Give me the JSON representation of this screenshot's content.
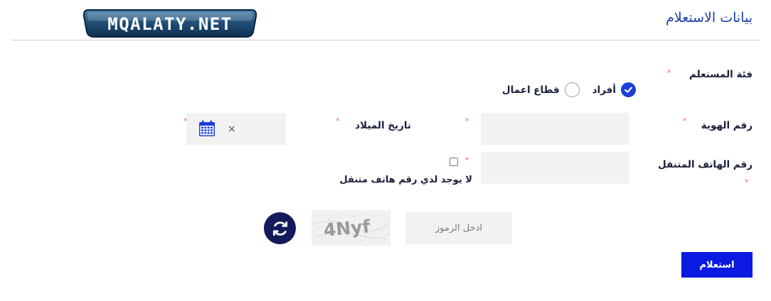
{
  "page": {
    "title": "بيانات الاستعلام",
    "logo_text": "MQALATY.NET"
  },
  "form": {
    "required_mark": "*",
    "user_category": {
      "label": "فئة المستعلم",
      "options": [
        {
          "label": "أفراد",
          "selected": true
        },
        {
          "label": "قطاع اعمال",
          "selected": false
        }
      ]
    },
    "id_number": {
      "label": "رقم الهوية",
      "value": ""
    },
    "birth_date": {
      "label": "تاريخ الميلاد",
      "value": "",
      "clear_symbol": "×"
    },
    "mobile": {
      "label": "رقم الهاتف المتنقل",
      "value": "",
      "no_phone_label": "لا يوجد لدي رقم هاتف متنقل",
      "no_phone_checked": false
    },
    "captcha": {
      "placeholder": "ادخل الرموز",
      "image_text": "4Nyf"
    },
    "submit_label": "استعلام"
  },
  "colors": {
    "accent": "#0b1ae0",
    "title": "#1b3fa8",
    "radio_selected": "#1b3fd8",
    "refresh_button": "#141b5c",
    "required": "#e46d6d",
    "field_bg": "#f2f2f2"
  },
  "icons": {
    "calendar": "calendar-icon",
    "refresh": "refresh-icon",
    "check": "check-icon",
    "clear": "clear-icon"
  }
}
